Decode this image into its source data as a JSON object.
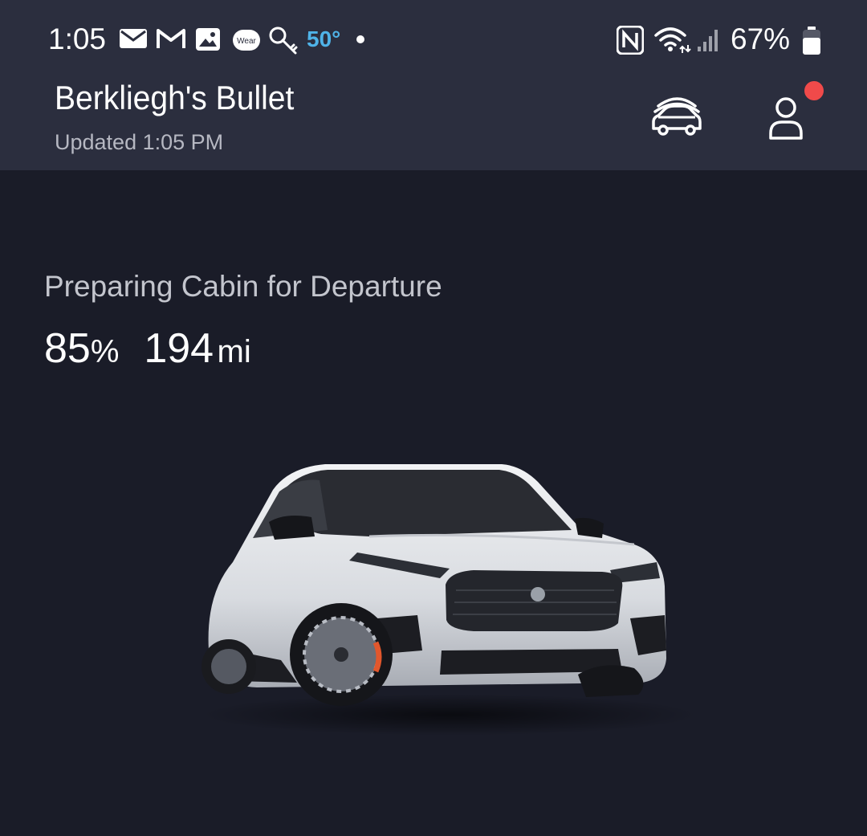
{
  "status_bar": {
    "time": "1:05",
    "notification_icons": [
      "mail-icon",
      "gmail-icon",
      "gallery-icon",
      "wear-icon",
      "key-icon"
    ],
    "wear_label": "Wear",
    "temperature": "50°",
    "nfc_label": "N",
    "battery_percent": "67%"
  },
  "header": {
    "vehicle_name": "Berkliegh's Bullet",
    "updated_text": "Updated 1:05 PM",
    "garage_icon": "vehicles-icon",
    "account_icon": "account-icon",
    "notification_badge_color": "#f04a4a"
  },
  "vehicle": {
    "status_text": "Preparing Cabin for Departure",
    "charge_value": "85",
    "charge_unit": "%",
    "range_value": "194",
    "range_unit": "mi"
  },
  "colors": {
    "background": "#1a1c28",
    "header_bg": "#2b2e3e",
    "temperature": "#4fb3e8"
  }
}
